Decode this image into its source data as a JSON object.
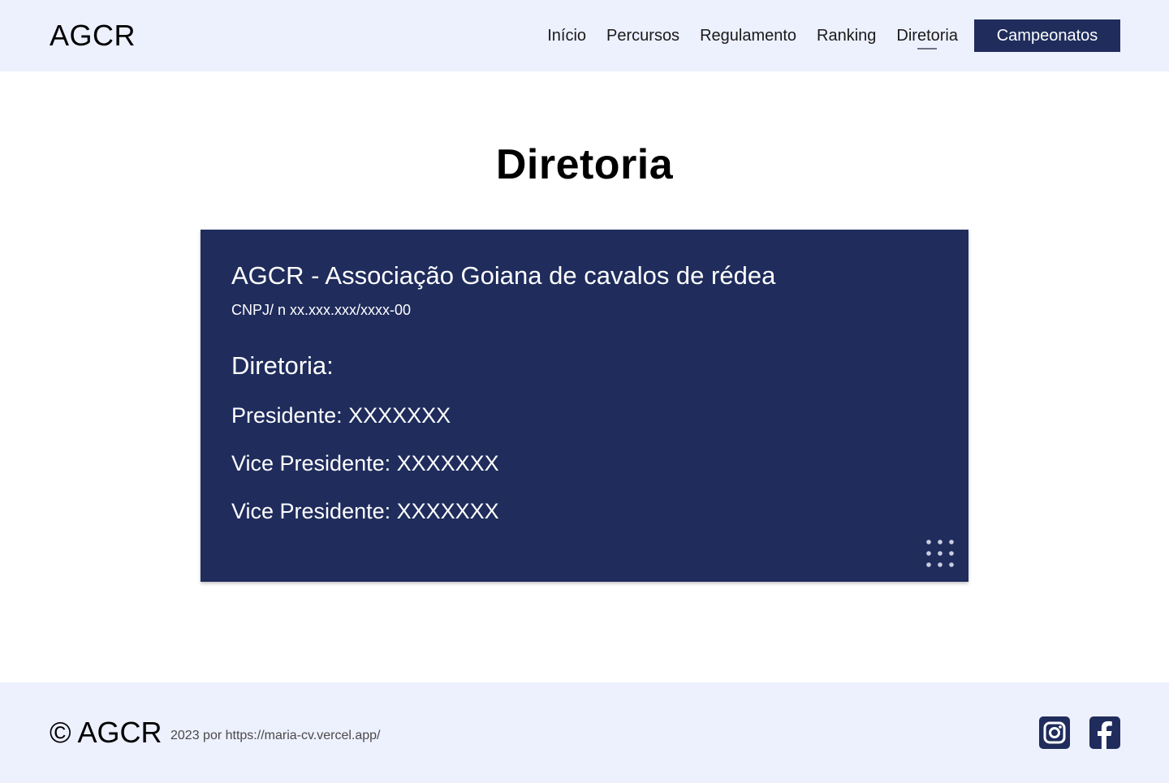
{
  "header": {
    "logo": "AGCR",
    "nav": [
      {
        "label": "Início"
      },
      {
        "label": "Percursos"
      },
      {
        "label": "Regulamento"
      },
      {
        "label": "Ranking"
      },
      {
        "label": "Diretoria",
        "active": true
      }
    ],
    "cta_label": "Campeonatos"
  },
  "main": {
    "title": "Diretoria",
    "card": {
      "title": "AGCR - Associação Goiana de cavalos de rédea",
      "cnpj": "CNPJ/ n xx.xxx.xxx/xxxx-00",
      "heading": "Diretoria:",
      "members": [
        "Presidente: XXXXXXX",
        "Vice Presidente: XXXXXXX",
        "Vice Presidente: XXXXXXX"
      ],
      "decoration_icon": "dots-grid-icon"
    }
  },
  "footer": {
    "copyright": "© AGCR",
    "credit": "2023 por https://maria-cv.vercel.app/",
    "social": [
      {
        "icon": "instagram-icon"
      },
      {
        "icon": "facebook-icon"
      }
    ]
  },
  "colors": {
    "header_bg": "#edf0fd",
    "accent_navy": "#1f2c5c",
    "text": "#111111",
    "white": "#ffffff"
  }
}
